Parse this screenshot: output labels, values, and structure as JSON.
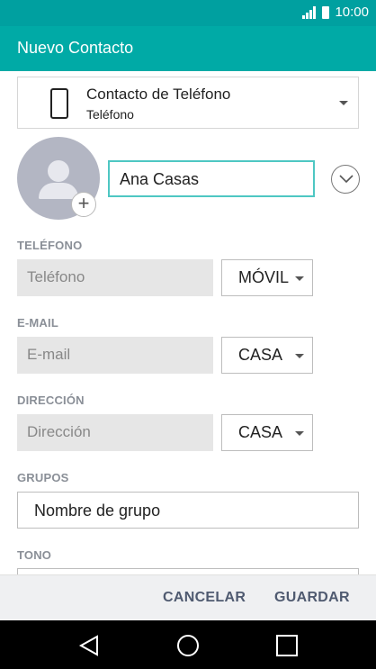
{
  "status_bar": {
    "time": "10:00"
  },
  "app_bar": {
    "title": "Nuevo Contacto"
  },
  "account": {
    "title": "Contacto de Teléfono",
    "subtitle": "Teléfono"
  },
  "name_field": {
    "value": "Ana Casas"
  },
  "phone": {
    "label": "TELÉFONO",
    "placeholder": "Teléfono",
    "type": "MÓVIL"
  },
  "email": {
    "label": "E-MAIL",
    "placeholder": "E-mail",
    "type": "CASA"
  },
  "address": {
    "label": "DIRECCIÓN",
    "placeholder": "Dirección",
    "type": "CASA"
  },
  "groups": {
    "label": "GRUPOS",
    "value": "Nombre de grupo"
  },
  "tone": {
    "label": "TONO"
  },
  "actions": {
    "cancel": "CANCELAR",
    "save": "GUARDAR"
  },
  "colors": {
    "status_bar": "#00a0a0",
    "app_bar": "#00aaa6",
    "focus_border": "#4ec7c3",
    "action_text": "#4f5a70"
  },
  "icons": {
    "signal": "signal-icon",
    "battery": "battery-icon",
    "phone": "phone-icon",
    "avatar": "avatar-placeholder-icon",
    "add": "plus-icon",
    "expand": "chevron-down-icon",
    "back": "back-icon",
    "home": "home-icon",
    "recents": "recents-icon"
  }
}
